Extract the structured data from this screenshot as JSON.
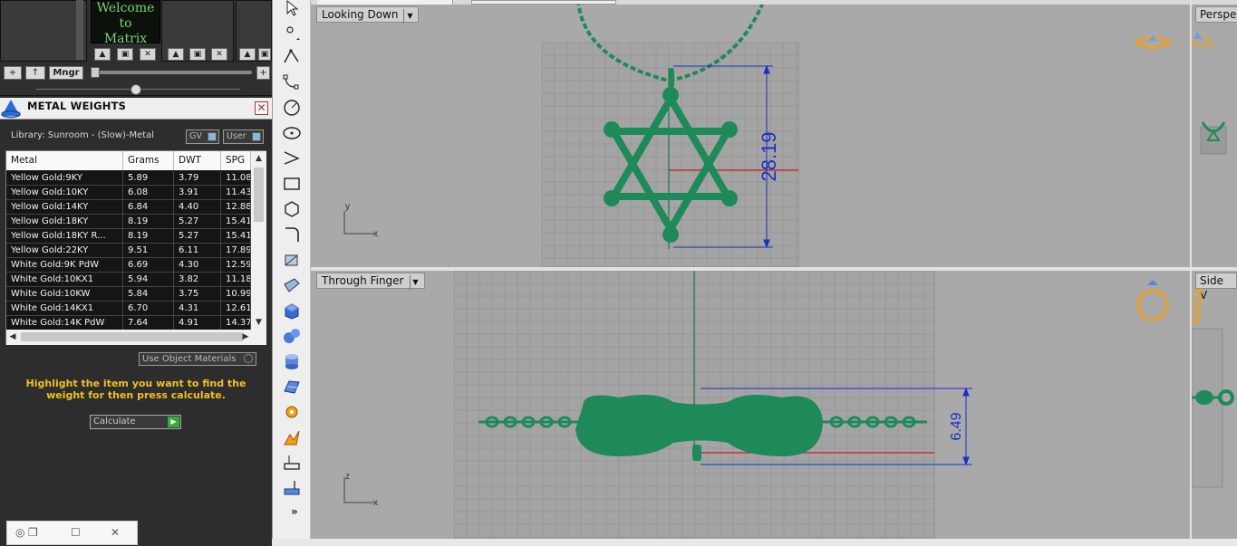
{
  "left_panel": {
    "welcome_text": "Welcome to Matrix",
    "mngr_label": "Mngr",
    "add_label": "+",
    "up_label": "↑",
    "plus_right": "+"
  },
  "metal_weights": {
    "title": "METAL WEIGHTS",
    "library": "Library: Sunroom - (Slow)-Metal",
    "toggle_gv": "GV",
    "toggle_user": "User",
    "columns": [
      "Metal",
      "Grams",
      "DWT",
      "SPG"
    ],
    "rows": [
      [
        "Yellow Gold:9KY",
        "5.89",
        "3.79",
        "11.08"
      ],
      [
        "Yellow Gold:10KY",
        "6.08",
        "3.91",
        "11.43"
      ],
      [
        "Yellow Gold:14KY",
        "6.84",
        "4.40",
        "12.88"
      ],
      [
        "Yellow Gold:18KY",
        "8.19",
        "5.27",
        "15.41"
      ],
      [
        "Yellow Gold:18KY R...",
        "8.19",
        "5.27",
        "15.41"
      ],
      [
        "Yellow Gold:22KY",
        "9.51",
        "6.11",
        "17.89"
      ],
      [
        "White Gold:9K PdW",
        "6.69",
        "4.30",
        "12.59"
      ],
      [
        "White Gold:10KX1",
        "5.94",
        "3.82",
        "11.18"
      ],
      [
        "White Gold:10KW",
        "5.84",
        "3.75",
        "10.99"
      ],
      [
        "White Gold:14KX1",
        "6.70",
        "4.31",
        "12.61"
      ],
      [
        "White Gold:14K PdW",
        "7.64",
        "4.91",
        "14.37"
      ]
    ],
    "use_object_materials": "Use Object Materials",
    "hint": "Highlight the item you want to find the weight for then press calculate.",
    "calculate_label": "Calculate"
  },
  "viewports": {
    "top_left": {
      "label": "Looking Down",
      "dimension": "28.19",
      "axis_a": "y",
      "axis_b": "x"
    },
    "bottom_left": {
      "label": "Through Finger",
      "dimension": "6.49",
      "axis_a": "z",
      "axis_b": "x"
    },
    "top_right": {
      "label": "Perspe"
    },
    "bottom_right": {
      "label": "Side V"
    }
  },
  "colors": {
    "model_green": "#1e8a5a",
    "dimension_blue": "#1a2ec8",
    "panel_dark": "#2d2d2d",
    "hint_yellow": "#f0c020"
  }
}
